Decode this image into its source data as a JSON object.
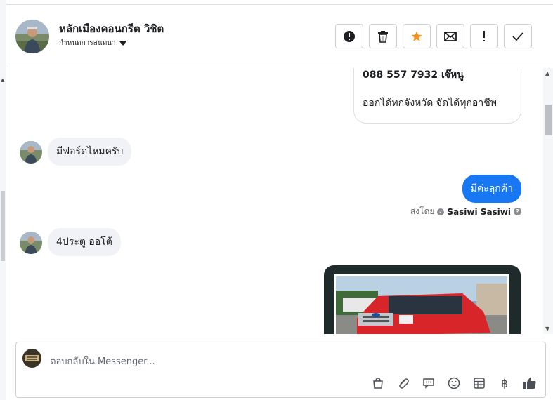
{
  "contact": {
    "name": "หลักเมืองคอนกรีต วิชิต",
    "subtitle": "กำหนดการสนทนา"
  },
  "header_actions": [
    {
      "name": "report-button",
      "icon": "alert-circle-icon"
    },
    {
      "name": "delete-button",
      "icon": "trash-icon"
    },
    {
      "name": "star-button",
      "icon": "star-icon",
      "color": "#f7931e"
    },
    {
      "name": "mark-unread-button",
      "icon": "envelope-icon"
    },
    {
      "name": "spam-button",
      "icon": "exclamation-icon"
    },
    {
      "name": "done-button",
      "icon": "check-icon"
    }
  ],
  "messages": {
    "card": {
      "line1": "088 557 7932 เจ๊หนู",
      "line2": "ออกได้ทกจังหวัด จัดได้ทุกอาชีพ"
    },
    "in1": "มีฟอร์ดไหมครับ",
    "out1": "มีค่ะลุกค้า",
    "sent_by_label": "ส่งโดย",
    "sender": "Sasiwi Sasiwi",
    "in2": "4ประตู ออโต้"
  },
  "composer": {
    "placeholder": "ตอบกลับใน Messenger..."
  },
  "composer_tools": [
    "bag-icon",
    "paperclip-icon",
    "speech-bubble-icon",
    "emoji-icon",
    "table-icon",
    "baht-icon",
    "thumbs-up-icon"
  ],
  "colors": {
    "accent_blue": "#1877f2",
    "bubble_gray": "#f0f2f5",
    "star_orange": "#f7931e"
  }
}
